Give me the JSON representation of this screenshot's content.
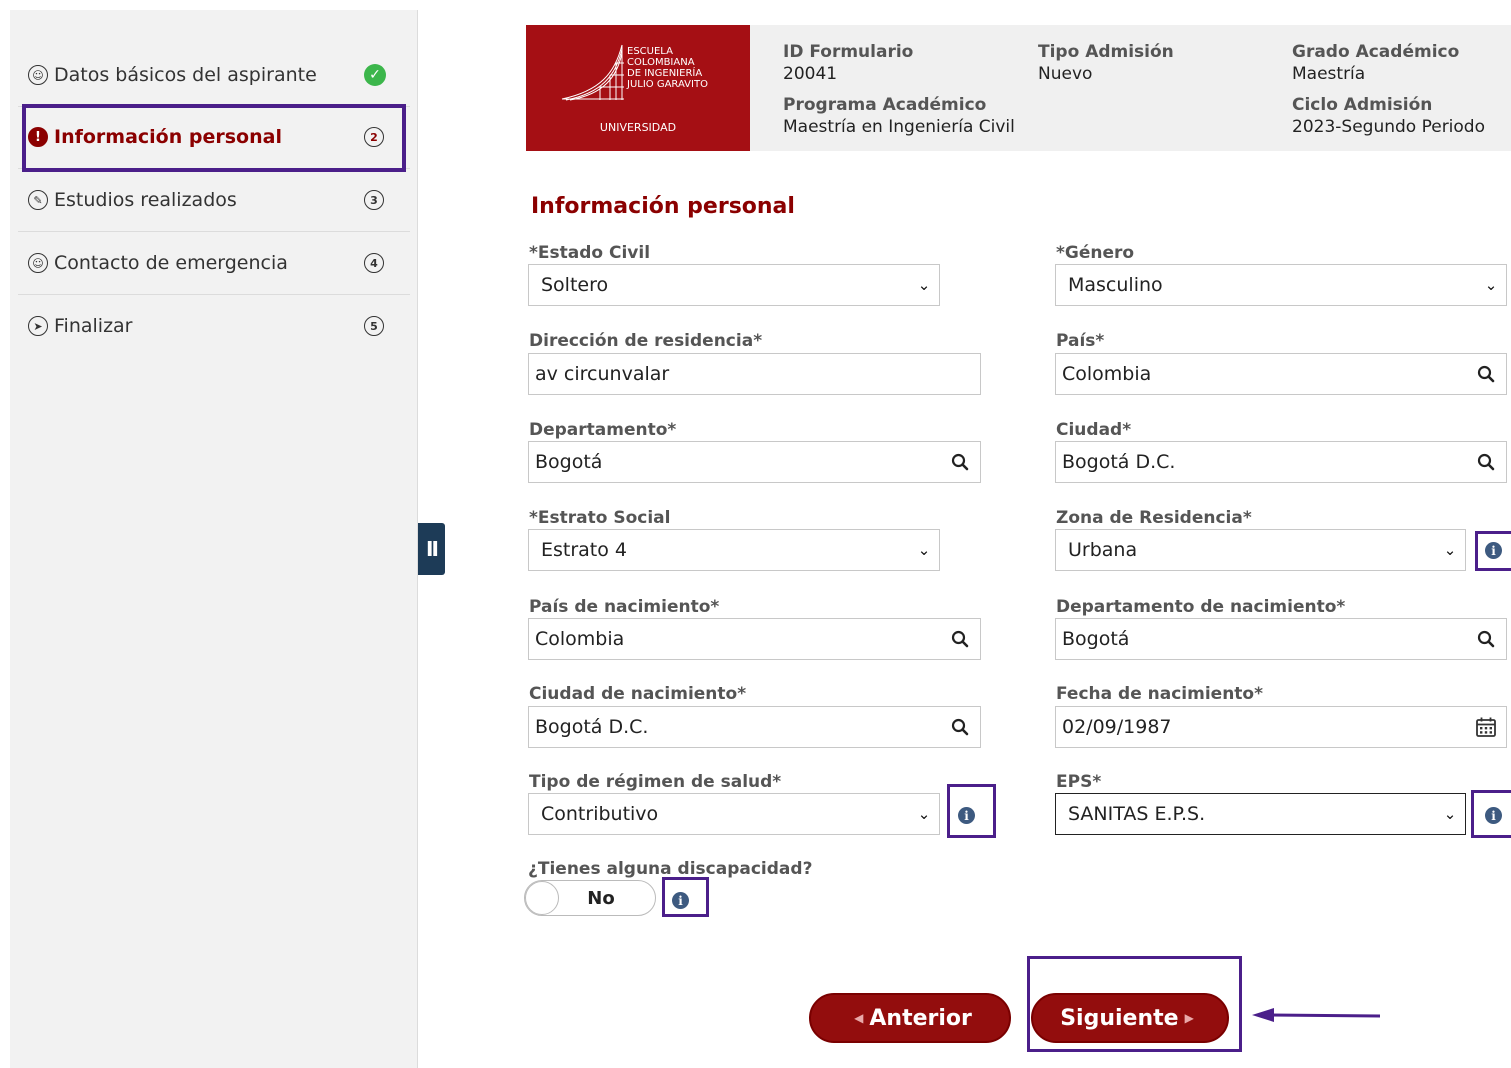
{
  "sidebar": {
    "items": [
      {
        "label": "Datos básicos del aspirante",
        "lead": "☺",
        "step": "",
        "status": "complete"
      },
      {
        "label": "Información personal",
        "lead": "!",
        "step": "2",
        "status": "active"
      },
      {
        "label": "Estudios realizados",
        "lead": "✎",
        "step": "3",
        "status": "pending"
      },
      {
        "label": "Contacto de emergencia",
        "lead": "☺",
        "step": "4",
        "status": "pending"
      },
      {
        "label": "Finalizar",
        "lead": "➤",
        "step": "5",
        "status": "pending"
      }
    ],
    "complete_mark": "✓"
  },
  "collapse_label": "II",
  "header": {
    "logo": {
      "lines": [
        "Escuela",
        "Colombiana",
        "de Ingeniería",
        "Julio Garavito"
      ],
      "universidad": "UNIVERSIDAD"
    },
    "id_formulario": {
      "label": "ID Formulario",
      "value": "20041"
    },
    "tipo_admision": {
      "label": "Tipo Admisión",
      "value": "Nuevo"
    },
    "grado_academico": {
      "label": "Grado Académico",
      "value": "Maestría"
    },
    "programa_academico": {
      "label": "Programa Académico",
      "value": "Maestría en Ingeniería Civil"
    },
    "ciclo_admision": {
      "label": "Ciclo Admisión",
      "value": "2023-Segundo Periodo"
    }
  },
  "form": {
    "title": "Información personal",
    "estado_civil": {
      "label": "*Estado Civil",
      "value": "Soltero"
    },
    "genero": {
      "label": "*Género",
      "value": "Masculino"
    },
    "direccion": {
      "label": "Dirección de residencia*",
      "value": "av circunvalar"
    },
    "pais": {
      "label": "País*",
      "value": "Colombia"
    },
    "departamento": {
      "label": "Departamento*",
      "value": "Bogotá"
    },
    "ciudad": {
      "label": "Ciudad*",
      "value": "Bogotá D.C."
    },
    "estrato": {
      "label": "*Estrato Social",
      "value": "Estrato 4"
    },
    "zona": {
      "label": "Zona de Residencia*",
      "value": "Urbana"
    },
    "pais_nacimiento": {
      "label": "País de nacimiento*",
      "value": "Colombia"
    },
    "depto_nacimiento": {
      "label": "Departamento de nacimiento*",
      "value": "Bogotá"
    },
    "ciudad_nacimiento": {
      "label": "Ciudad de nacimiento*",
      "value": "Bogotá D.C."
    },
    "fecha_nacimiento": {
      "label": "Fecha de nacimiento*",
      "value": "02/09/1987"
    },
    "regimen_salud": {
      "label": "Tipo de régimen de salud*",
      "value": "Contributivo"
    },
    "eps": {
      "label": "EPS*",
      "value": "SANITAS E.P.S."
    },
    "discapacidad": {
      "label": "¿Tienes alguna discapacidad?",
      "value": "No"
    }
  },
  "buttons": {
    "prev": "Anterior",
    "next": "Siguiente"
  },
  "icons": {
    "info": "i",
    "chevron": "⌄"
  },
  "colors": {
    "brand": "#930d0d",
    "annotation": "#4b1f8a",
    "success": "#3cb64b",
    "info": "#3d5a80"
  }
}
